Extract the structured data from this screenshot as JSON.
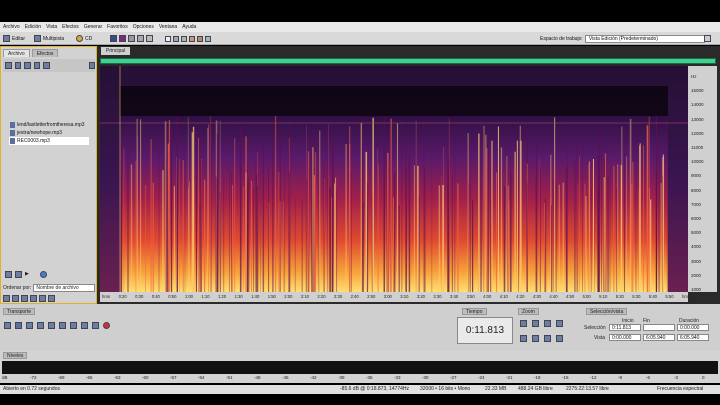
{
  "menu": [
    "Archivo",
    "Edición",
    "Vista",
    "Efectos",
    "Generar",
    "Favoritos",
    "Opciones",
    "Ventana",
    "Ayuda"
  ],
  "toolbar": {
    "editar": "Editar",
    "multipista": "Multipista",
    "cd": "CD",
    "workspace_label": "Espacio de trabajo:",
    "workspace_value": "Vista Edición (Predeterminado)"
  },
  "files_panel": {
    "tabs": [
      "Archivo",
      "Efectos"
    ],
    "files": [
      "lend/lastletterfromtheresa.mp3",
      "jestra/newhope.mp3",
      "REC0003.mp3"
    ],
    "selected_index": 2,
    "sort_label": "Ordenar por:",
    "sort_value": "Nombre de archivo"
  },
  "editor": {
    "tab": "Principal",
    "hz_labels": [
      "Hz",
      "15000",
      "14000",
      "13000",
      "12000",
      "11000",
      "10000",
      "9000",
      "8000",
      "7000",
      "6000",
      "5000",
      "4000",
      "3000",
      "2000",
      "1000"
    ],
    "time_labels": [
      "hms",
      "0:20",
      "0:30",
      "0:40",
      "0:50",
      "1:00",
      "1:10",
      "1:20",
      "1:30",
      "1:40",
      "1:50",
      "2:00",
      "2:10",
      "2:20",
      "2:30",
      "2:40",
      "2:50",
      "3:00",
      "3:10",
      "3:20",
      "3:30",
      "3:40",
      "3:50",
      "4:00",
      "4:10",
      "4:20",
      "4:30",
      "4:40",
      "4:50",
      "5:00",
      "5:10",
      "5:20",
      "5:30",
      "5:40",
      "5:50",
      "hms"
    ]
  },
  "transport": {
    "title": "Transporte"
  },
  "time": {
    "title": "Tiempo",
    "value": "0:11.813"
  },
  "zoom": {
    "title": "Zoom"
  },
  "selection": {
    "title": "Selección/vista",
    "headers": [
      "Inicio",
      "Fin",
      "Duración"
    ],
    "row_labels": [
      "Selección",
      "Vista"
    ],
    "rows": [
      [
        "0:11.813",
        "",
        "0:00.000"
      ],
      [
        "0:00.000",
        "6:05.940",
        "6:05.940"
      ]
    ]
  },
  "levels": {
    "title": "Niveles",
    "ticks": [
      "dB",
      "-72",
      "-69",
      "-66",
      "-63",
      "-60",
      "-57",
      "-54",
      "-51",
      "-48",
      "-45",
      "-42",
      "-39",
      "-36",
      "-33",
      "-30",
      "-27",
      "-24",
      "-21",
      "-18",
      "-15",
      "-12",
      "-9",
      "-6",
      "-3",
      "0"
    ]
  },
  "status": {
    "left": "Abierto en 0.72 segundos",
    "db": "-85.6 dB @ 0:18.873, 14774Hz",
    "format": "32000 • 16 bits • Mono",
    "size": "22.33 MB",
    "free": "488.24 GB libre",
    "duration": "2275:22:13.57 libre",
    "view": "Frecuencia espectral"
  },
  "colors": {
    "overview": "#3fcf8e",
    "spectral_low": "#1a0a2a",
    "spectral_mid": "#c02a3a",
    "spectral_high": "#ffdd55",
    "panel_border_active": "#e0b12b"
  }
}
